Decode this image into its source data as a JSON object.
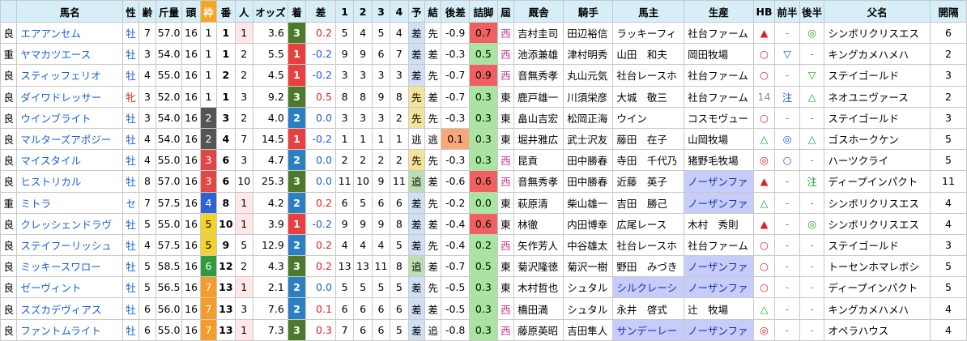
{
  "headers": [
    "",
    "馬名",
    "性",
    "齢",
    "斤量",
    "頭",
    "枠",
    "番",
    "人",
    "オッズ",
    "着",
    "差",
    "1",
    "2",
    "3",
    "4",
    "予",
    "結",
    "後差",
    "詰脚",
    "屆",
    "厩舎",
    "騎手",
    "馬主",
    "生産",
    "HB",
    "前半",
    "後半",
    "父名",
    "開隔"
  ],
  "colors": {
    "header_bg": "#d5eef7",
    "waku_header": "#f5a623",
    "chaku": {
      "3": "#4a7a2a",
      "1": "#e84040",
      "2": "#2e7fc1"
    },
    "waku": {
      "1": "#ffffff",
      "2": "#555555",
      "3": "#e04848",
      "4": "#2d63d4",
      "5": "#f4d22c",
      "6": "#2e9b3e",
      "7": "#f59c2a"
    },
    "yo": {
      "差": "#cfe0f5",
      "先": "#f4e39a",
      "逃": "#ffffff",
      "追": "#b8e0b0"
    },
    "diff_orange": "#f7a77a",
    "tsume_red": "#f06060",
    "tsume_green": "#a8e6a0",
    "blue_cell": "#c6cdfa"
  },
  "rows": [
    {
      "baba": "良",
      "name": "エアアンセム",
      "sex": "牡",
      "age": "7",
      "kin": "57.0",
      "to": "16",
      "waku": "1",
      "ban": "1",
      "nin": "1",
      "odds": "3.6",
      "chaku": "3",
      "sa": "0.2",
      "c1": "5",
      "c2": "4",
      "c3": "5",
      "c4": "4",
      "yo": "差",
      "ke": "先",
      "kosa": "-0.9",
      "tsume": "0.7",
      "zo": "西",
      "kyusha": "吉村圭司",
      "kishu": "田辺裕信",
      "banushi": "ラッキーフィ",
      "seisan": "社台ファーム",
      "hb": "▲",
      "zen": "-",
      "kou": "◎",
      "chichi": "シンボリクリスエス",
      "kan": "6"
    },
    {
      "baba": "重",
      "name": "ヤマカツエース",
      "sex": "牡",
      "age": "3",
      "kin": "54.0",
      "to": "16",
      "waku": "1",
      "ban": "1",
      "nin": "2",
      "odds": "5.5",
      "chaku": "1",
      "sa": "-0.2",
      "c1": "9",
      "c2": "9",
      "c3": "6",
      "c4": "7",
      "yo": "差",
      "ke": "差",
      "kosa": "-0.3",
      "tsume": "0.5",
      "zo": "西",
      "kyusha": "池添兼雄",
      "kishu": "津村明秀",
      "banushi": "山田　和夫",
      "seisan": "岡田牧場",
      "hb": "○",
      "zen": "▽",
      "kou": "-",
      "chichi": "キングカメハメハ",
      "kan": "2"
    },
    {
      "baba": "良",
      "name": "スティッフェリオ",
      "sex": "牡",
      "age": "4",
      "kin": "55.0",
      "to": "16",
      "waku": "1",
      "ban": "2",
      "nin": "2",
      "odds": "4.5",
      "chaku": "1",
      "sa": "-0.2",
      "c1": "3",
      "c2": "3",
      "c3": "3",
      "c4": "3",
      "yo": "差",
      "ke": "先",
      "kosa": "-0.7",
      "tsume": "0.9",
      "zo": "西",
      "kyusha": "音無秀孝",
      "kishu": "丸山元気",
      "banushi": "社台レースホ",
      "seisan": "社台ファーム",
      "hb": "○",
      "zen": "-",
      "kou": "▽",
      "chichi": "ステイゴールド",
      "kan": "3"
    },
    {
      "baba": "良",
      "name": "ダイワドレッサー",
      "sex": "牝",
      "age": "3",
      "kin": "52.0",
      "to": "16",
      "waku": "1",
      "ban": "1",
      "nin": "3",
      "odds": "9.2",
      "chaku": "3",
      "sa": "0.5",
      "c1": "8",
      "c2": "8",
      "c3": "9",
      "c4": "8",
      "yo": "先",
      "ke": "差",
      "kosa": "-0.7",
      "tsume": "0.3",
      "zo": "東",
      "kyusha": "鹿戸雄一",
      "kishu": "川須栄彦",
      "banushi": "大城　敬三",
      "seisan": "社台ファーム",
      "hb": "14",
      "zen": "注",
      "kou": "△",
      "chichi": "ネオユニヴァース",
      "kan": "2"
    },
    {
      "baba": "良",
      "name": "ウインブライト",
      "sex": "牡",
      "age": "3",
      "kin": "54.0",
      "to": "16",
      "waku": "2",
      "ban": "3",
      "nin": "2",
      "odds": "4.0",
      "chaku": "2",
      "sa": "0.0",
      "c1": "3",
      "c2": "3",
      "c3": "3",
      "c4": "2",
      "yo": "先",
      "ke": "先",
      "kosa": "-0.3",
      "tsume": "0.3",
      "zo": "東",
      "kyusha": "畠山吉宏",
      "kishu": "松岡正海",
      "banushi": "ウイン",
      "seisan": "コスモヴュー",
      "hb": "○",
      "zen": "-",
      "kou": "-",
      "chichi": "ステイゴールド",
      "kan": "3"
    },
    {
      "baba": "良",
      "name": "マルターズアポジー",
      "sex": "牡",
      "age": "4",
      "kin": "54.0",
      "to": "16",
      "waku": "2",
      "ban": "4",
      "nin": "7",
      "odds": "14.5",
      "chaku": "1",
      "sa": "-0.2",
      "c1": "1",
      "c2": "1",
      "c3": "1",
      "c4": "1",
      "yo": "逃",
      "ke": "逃",
      "kosa": "0.1",
      "tsume": "0.3",
      "zo": "東",
      "kyusha": "堀井雅広",
      "kishu": "武士沢友",
      "banushi": "藤田　在子",
      "seisan": "山岡牧場",
      "hb": "△",
      "zen": "◎",
      "kou": "△",
      "chichi": "ゴスホークケン",
      "kan": "5"
    },
    {
      "baba": "良",
      "name": "マイスタイル",
      "sex": "牡",
      "age": "4",
      "kin": "55.0",
      "to": "16",
      "waku": "3",
      "ban": "6",
      "nin": "3",
      "odds": "4.7",
      "chaku": "2",
      "sa": "0.0",
      "c1": "2",
      "c2": "2",
      "c3": "2",
      "c4": "2",
      "yo": "先",
      "ke": "先",
      "kosa": "-0.3",
      "tsume": "0.3",
      "zo": "西",
      "kyusha": "昆貢",
      "kishu": "田中勝春",
      "banushi": "寺田　千代乃",
      "seisan": "猪野毛牧場",
      "hb": "◎",
      "zen": "○",
      "kou": "-",
      "chichi": "ハーツクライ",
      "kan": "5"
    },
    {
      "baba": "良",
      "name": "ヒストリカル",
      "sex": "牡",
      "age": "8",
      "kin": "57.0",
      "to": "16",
      "waku": "3",
      "ban": "6",
      "nin": "10",
      "odds": "25.3",
      "chaku": "3",
      "sa": "0.0",
      "c1": "11",
      "c2": "10",
      "c3": "9",
      "c4": "11",
      "yo": "追",
      "ke": "差",
      "kosa": "-0.6",
      "tsume": "0.6",
      "zo": "西",
      "kyusha": "音無秀孝",
      "kishu": "田中勝春",
      "banushi": "近藤　英子",
      "seisan": "ノーザンファ",
      "hb": "▲",
      "zen": "-",
      "kou": "注",
      "chichi": "ディープインパクト",
      "kan": "11"
    },
    {
      "baba": "重",
      "name": "ミトラ",
      "sex": "セ",
      "age": "7",
      "kin": "57.5",
      "to": "16",
      "waku": "4",
      "ban": "8",
      "nin": "1",
      "odds": "4.2",
      "chaku": "2",
      "sa": "0.2",
      "c1": "6",
      "c2": "5",
      "c3": "6",
      "c4": "6",
      "yo": "差",
      "ke": "先",
      "kosa": "-0.2",
      "tsume": "0.0",
      "zo": "東",
      "kyusha": "萩原清",
      "kishu": "柴山雄一",
      "banushi": "吉田　勝己",
      "seisan": "ノーザンファ",
      "hb": "△",
      "zen": "-",
      "kou": "-",
      "chichi": "シンボリクリスエス",
      "kan": "4"
    },
    {
      "baba": "良",
      "name": "クレッシェンドラヴ",
      "sex": "牡",
      "age": "5",
      "kin": "55.0",
      "to": "16",
      "waku": "5",
      "ban": "10",
      "nin": "1",
      "odds": "3.9",
      "chaku": "1",
      "sa": "-0.2",
      "c1": "9",
      "c2": "9",
      "c3": "9",
      "c4": "8",
      "yo": "差",
      "ke": "差",
      "kosa": "-0.4",
      "tsume": "0.6",
      "zo": "東",
      "kyusha": "林徹",
      "kishu": "内田博幸",
      "banushi": "広尾レース",
      "seisan": "木村　秀則",
      "hb": "▲",
      "zen": "-",
      "kou": "◎",
      "chichi": "シンボリクリスエス",
      "kan": "4"
    },
    {
      "baba": "良",
      "name": "ステイフーリッシュ",
      "sex": "牡",
      "age": "4",
      "kin": "57.5",
      "to": "16",
      "waku": "5",
      "ban": "9",
      "nin": "5",
      "odds": "12.9",
      "chaku": "2",
      "sa": "0.2",
      "c1": "4",
      "c2": "4",
      "c3": "4",
      "c4": "5",
      "yo": "差",
      "ke": "先",
      "kosa": "-0.4",
      "tsume": "0.2",
      "zo": "西",
      "kyusha": "矢作芳人",
      "kishu": "中谷雄太",
      "banushi": "社台レースホ",
      "seisan": "社台ファーム",
      "hb": "○",
      "zen": "-",
      "kou": "-",
      "chichi": "ステイゴールド",
      "kan": "3"
    },
    {
      "baba": "良",
      "name": "ミッキースワロー",
      "sex": "牡",
      "age": "5",
      "kin": "58.5",
      "to": "16",
      "waku": "6",
      "ban": "12",
      "nin": "2",
      "odds": "4.3",
      "chaku": "3",
      "sa": "0.2",
      "c1": "13",
      "c2": "13",
      "c3": "11",
      "c4": "8",
      "yo": "追",
      "ke": "差",
      "kosa": "-0.7",
      "tsume": "0.5",
      "zo": "東",
      "kyusha": "菊沢隆徳",
      "kishu": "菊沢一樹",
      "banushi": "野田　みづき",
      "seisan": "ノーザンファ",
      "hb": "○",
      "zen": "-",
      "kou": "-",
      "chichi": "トーセンホマレボシ",
      "kan": "5"
    },
    {
      "baba": "良",
      "name": "ゼーヴィント",
      "sex": "牡",
      "age": "5",
      "kin": "56.5",
      "to": "16",
      "waku": "7",
      "ban": "13",
      "nin": "1",
      "odds": "2.1",
      "chaku": "2",
      "sa": "0.0",
      "c1": "5",
      "c2": "5",
      "c3": "5",
      "c4": "5",
      "yo": "差",
      "ke": "先",
      "kosa": "-0.5",
      "tsume": "0.3",
      "zo": "東",
      "kyusha": "木村哲也",
      "kishu": "シュタル",
      "banushi": "シルクレーシ",
      "seisan": "ノーザンファ",
      "hb": "○",
      "zen": "-",
      "kou": "-",
      "chichi": "ディープインパクト",
      "kan": "5"
    },
    {
      "baba": "良",
      "name": "スズカデヴィアス",
      "sex": "牡",
      "age": "6",
      "kin": "56.0",
      "to": "16",
      "waku": "7",
      "ban": "13",
      "nin": "3",
      "odds": "7.6",
      "chaku": "2",
      "sa": "0.1",
      "c1": "6",
      "c2": "6",
      "c3": "6",
      "c4": "6",
      "yo": "差",
      "ke": "差",
      "kosa": "-0.5",
      "tsume": "0.3",
      "zo": "西",
      "kyusha": "橋田満",
      "kishu": "シュタル",
      "banushi": "永井　啓式",
      "seisan": "辻　牧場",
      "hb": "△",
      "zen": "-",
      "kou": "-",
      "chichi": "キングカメハメハ",
      "kan": "4"
    },
    {
      "baba": "良",
      "name": "ファントムライト",
      "sex": "牡",
      "age": "6",
      "kin": "55.0",
      "to": "16",
      "waku": "7",
      "ban": "13",
      "nin": "1",
      "odds": "7.3",
      "chaku": "3",
      "sa": "0.3",
      "c1": "7",
      "c2": "6",
      "c3": "6",
      "c4": "5",
      "yo": "差",
      "ke": "追",
      "kosa": "-0.8",
      "tsume": "0.3",
      "zo": "西",
      "kyusha": "藤原英昭",
      "kishu": "吉田隼人",
      "banushi": "サンデーレー",
      "seisan": "ノーザンファ",
      "hb": "◎",
      "zen": "-",
      "kou": "-",
      "chichi": "オペラハウス",
      "kan": "4"
    }
  ]
}
